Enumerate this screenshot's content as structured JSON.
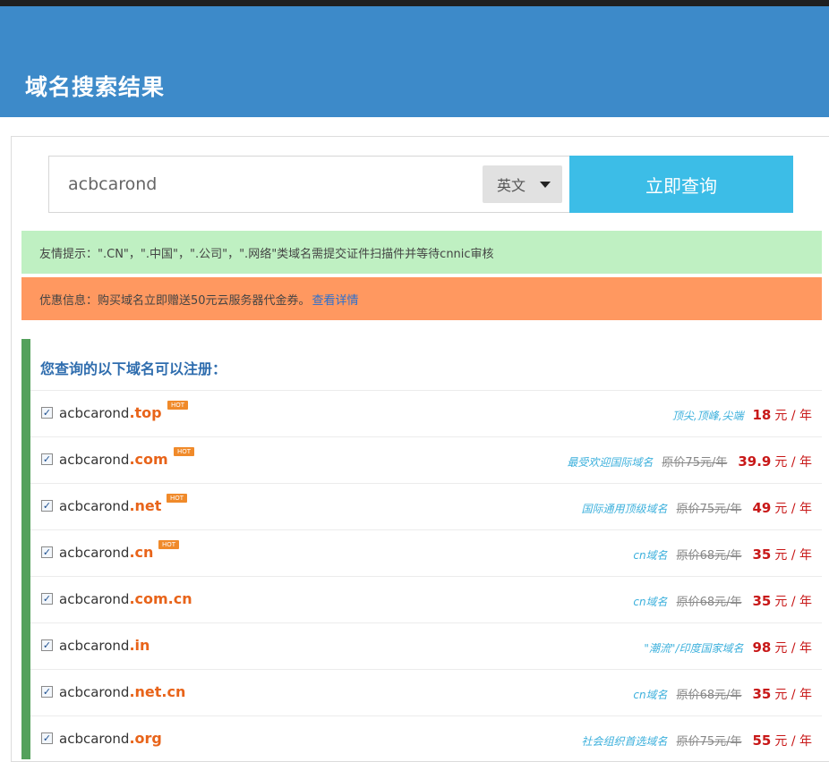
{
  "header": {
    "title": "域名搜索结果"
  },
  "search": {
    "value": "acbcarond",
    "language": "英文",
    "button_label": "立即查询"
  },
  "notices": {
    "tip": "友情提示：\".CN\"，\".中国\"，\".公司\"，\".网络\"类域名需提交证件扫描件并等待cnnic审核",
    "promo": "优惠信息：购买域名立即赠送50元云服务器代金券。",
    "promo_link": "查看详情"
  },
  "results": {
    "title": "您查询的以下域名可以注册：",
    "hot_label": "HOT",
    "check_mark": "✓",
    "rows": [
      {
        "base": "acbcarond",
        "tld": ".top",
        "hot": true,
        "desc": "顶尖,顶峰,尖端",
        "orig": "",
        "price": "18",
        "unit": "元 / 年",
        "checked": true
      },
      {
        "base": "acbcarond",
        "tld": ".com",
        "hot": true,
        "desc": "最受欢迎国际域名",
        "orig": "原价75元/年",
        "price": "39.9",
        "unit": "元 / 年",
        "checked": true
      },
      {
        "base": "acbcarond",
        "tld": ".net",
        "hot": true,
        "desc": "国际通用顶级域名",
        "orig": "原价75元/年",
        "price": "49",
        "unit": "元 / 年",
        "checked": true
      },
      {
        "base": "acbcarond",
        "tld": ".cn",
        "hot": true,
        "desc": "cn域名",
        "orig": "原价68元/年",
        "price": "35",
        "unit": "元 / 年",
        "checked": true
      },
      {
        "base": "acbcarond",
        "tld": ".com.cn",
        "hot": false,
        "desc": "cn域名",
        "orig": "原价68元/年",
        "price": "35",
        "unit": "元 / 年",
        "checked": true
      },
      {
        "base": "acbcarond",
        "tld": ".in",
        "hot": false,
        "desc": "\"潮流\"/印度国家域名",
        "orig": "",
        "price": "98",
        "unit": "元 / 年",
        "checked": true
      },
      {
        "base": "acbcarond",
        "tld": ".net.cn",
        "hot": false,
        "desc": "cn域名",
        "orig": "原价68元/年",
        "price": "35",
        "unit": "元 / 年",
        "checked": true
      },
      {
        "base": "acbcarond",
        "tld": ".org",
        "hot": false,
        "desc": "社会组织首选域名",
        "orig": "原价75元/年",
        "price": "55",
        "unit": "元 / 年",
        "checked": true
      }
    ]
  }
}
